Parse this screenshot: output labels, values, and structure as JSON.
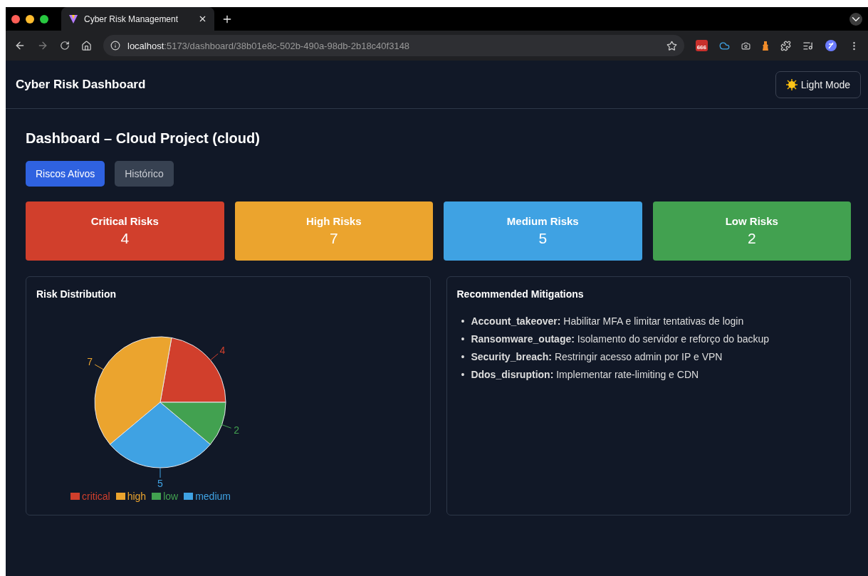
{
  "browser": {
    "tab_title": "Cyber Risk Management",
    "url_host": "localhost",
    "url_path": ":5173/dashboard/38b01e8c-502b-490a-98db-2b18c40f3148",
    "extension_badge": "666"
  },
  "header": {
    "title": "Cyber Risk Dashboard",
    "theme_button": "Light Mode"
  },
  "page_title": "Dashboard – Cloud Project (cloud)",
  "tabs": [
    {
      "label": "Riscos Ativos",
      "selected": true
    },
    {
      "label": "Histórico",
      "selected": false
    }
  ],
  "summary_cards": [
    {
      "label": "Critical Risks",
      "value": "4",
      "color": "#d13f2c"
    },
    {
      "label": "High Risks",
      "value": "7",
      "color": "#eba42e"
    },
    {
      "label": "Medium Risks",
      "value": "5",
      "color": "#3fa2e3"
    },
    {
      "label": "Low Risks",
      "value": "2",
      "color": "#42a150"
    }
  ],
  "risk_distribution": {
    "title": "Risk Distribution",
    "chart_data": {
      "type": "pie",
      "categories": [
        "critical",
        "high",
        "medium",
        "low"
      ],
      "values": [
        4,
        7,
        5,
        2
      ],
      "colors": [
        "#d13f2c",
        "#eba42e",
        "#3fa2e3",
        "#42a150"
      ],
      "legend": true,
      "data_labels": true
    }
  },
  "mitigations": {
    "title": "Recommended Mitigations",
    "items": [
      {
        "marker": "•",
        "text": "**Account_takeover:** Habilitar MFA e limitar tentativas de login"
      },
      {
        "marker": "•",
        "text": "**Ransomware_outage:** Isolamento do servidor e reforço do backup"
      },
      {
        "marker": "•",
        "text": "**Security_breach:** Restringir acesso admin por IP e VPN"
      },
      {
        "marker": "•",
        "text": "**Ddos_disruption:** Implementar rate-limiting e CDN"
      }
    ]
  }
}
